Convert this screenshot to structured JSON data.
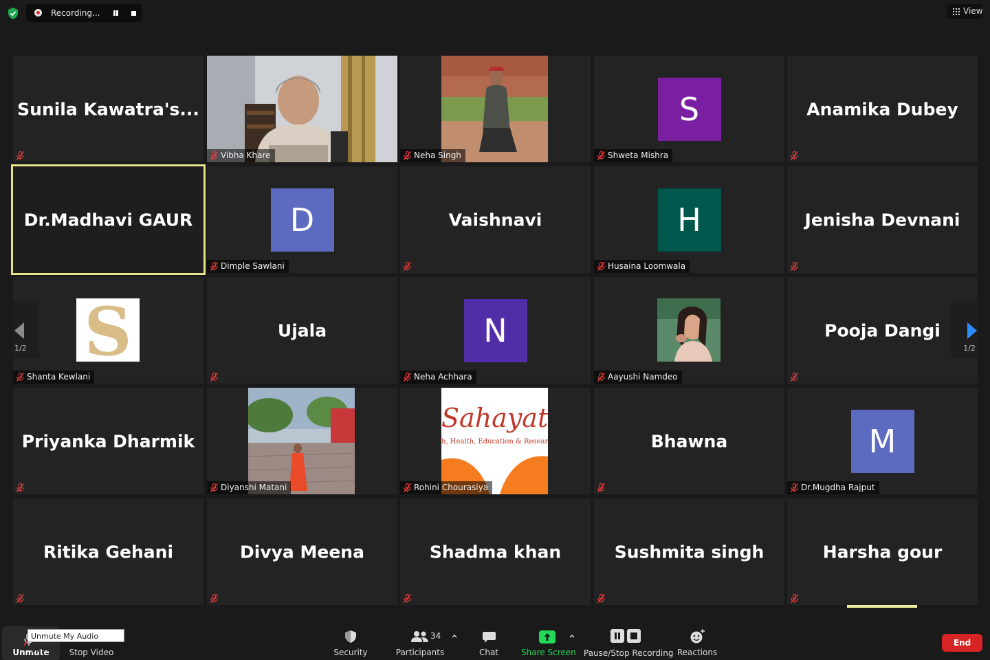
{
  "topbar": {
    "recording_label": "Recording...",
    "view_label": "View"
  },
  "pager": {
    "left_page": "1/2",
    "right_page": "1/2"
  },
  "tiles": [
    {
      "name": "Sunila  Kawatra's...",
      "kind": "name"
    },
    {
      "name": "Vibha Khare",
      "kind": "photo"
    },
    {
      "name": "Neha Singh",
      "kind": "photo"
    },
    {
      "name": "Shweta Mishra",
      "kind": "avatar",
      "letter": "S",
      "color": "#7b1fa2"
    },
    {
      "name": "Anamika Dubey",
      "kind": "name"
    },
    {
      "name": "Dr.Madhavi GAUR",
      "kind": "name",
      "active": true
    },
    {
      "name": "Dimple Sawlani",
      "kind": "avatar",
      "letter": "D",
      "color": "#5c6bc0"
    },
    {
      "name": "Vaishnavi",
      "kind": "name"
    },
    {
      "name": "Husaina Loomwala",
      "kind": "avatar",
      "letter": "H",
      "color": "#00574b"
    },
    {
      "name": "Jenisha Devnani",
      "kind": "name"
    },
    {
      "name": "Shanta Kewlani",
      "kind": "photo",
      "letter": "S"
    },
    {
      "name": "Ujala",
      "kind": "name"
    },
    {
      "name": "Neha Achhara",
      "kind": "avatar",
      "letter": "N",
      "color": "#512da8"
    },
    {
      "name": "Aayushi Namdeo",
      "kind": "photo"
    },
    {
      "name": "Pooja Dangi",
      "kind": "name"
    },
    {
      "name": "Priyanka Dharmik",
      "kind": "name"
    },
    {
      "name": "Diyanshi Matani",
      "kind": "photo"
    },
    {
      "name": "Rohini Chourasiya",
      "kind": "photo",
      "logo_text": "Sahayata",
      "logo_sub": "h, Health, Education & Research Fo"
    },
    {
      "name": "Bhawna",
      "kind": "name"
    },
    {
      "name": "Dr.Mugdha Rajput",
      "kind": "avatar",
      "letter": "M",
      "color": "#5c6bc0"
    },
    {
      "name": "Ritika Gehani",
      "kind": "name"
    },
    {
      "name": "Divya Meena",
      "kind": "name"
    },
    {
      "name": "Shadma khan",
      "kind": "name"
    },
    {
      "name": "Sushmita singh",
      "kind": "name"
    },
    {
      "name": "Harsha gour",
      "kind": "name"
    }
  ],
  "toolbar": {
    "unmute_label": "Unmute",
    "unmute_tooltip": "Unmute My Audio (Alt+A)",
    "stop_video_label": "Stop Video",
    "security_label": "Security",
    "participants_label": "Participants",
    "participants_count": "34",
    "chat_label": "Chat",
    "share_screen_label": "Share Screen",
    "pause_stop_label": "Pause/Stop Recording",
    "reactions_label": "Reactions",
    "end_label": "End"
  },
  "colors": {
    "share_green": "#23d959",
    "end_red": "#d62424",
    "active_outline": "#e4e38a"
  }
}
